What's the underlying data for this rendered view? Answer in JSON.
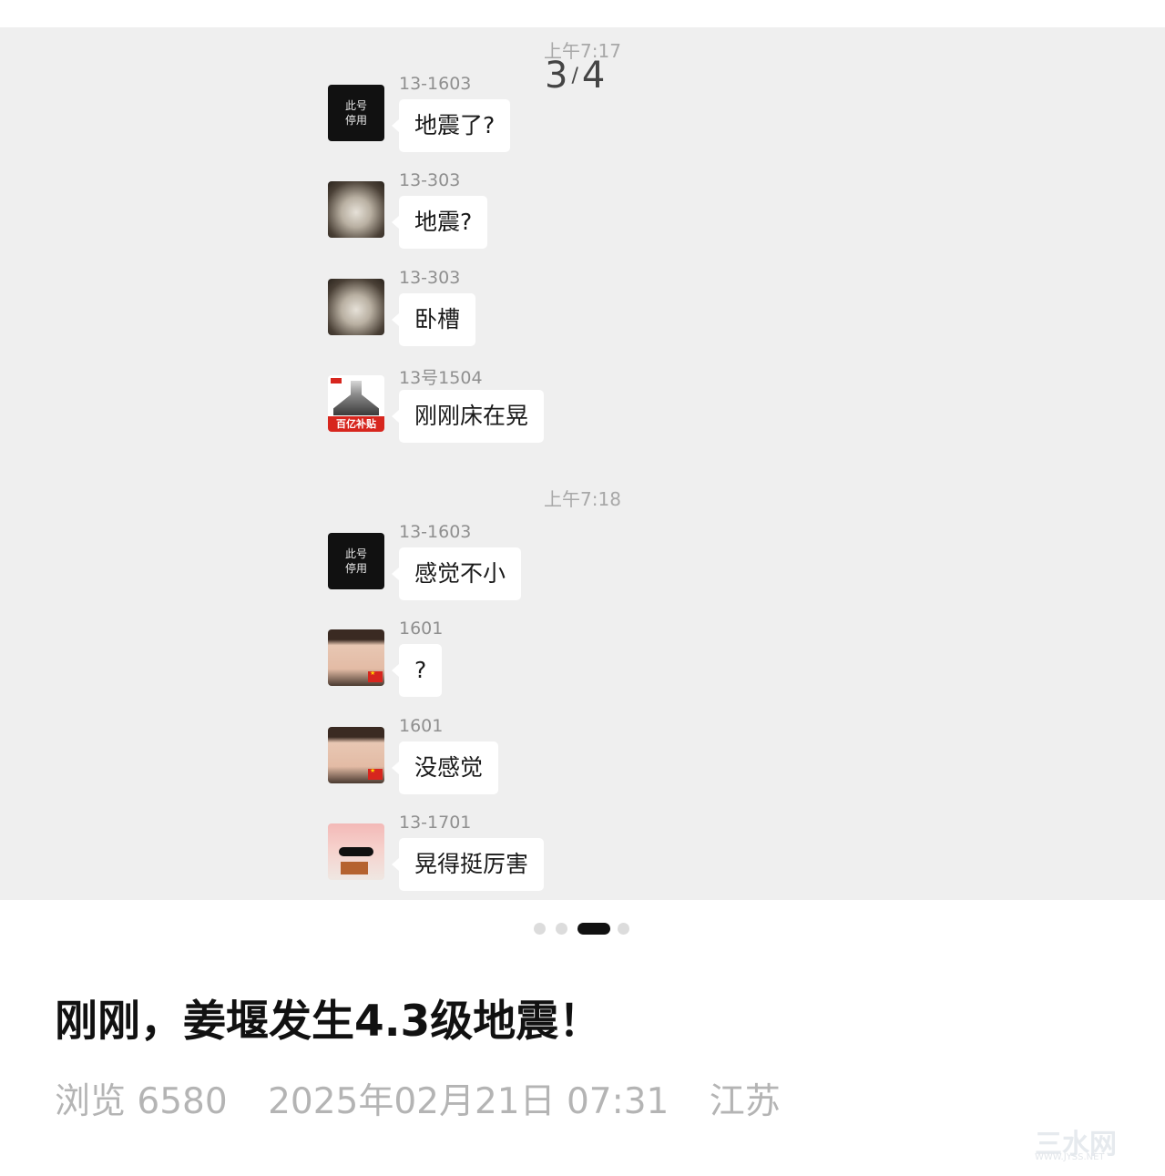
{
  "chat": {
    "page_counter": {
      "current": "3",
      "separator": "/",
      "total": "4"
    },
    "time_separators": [
      "上午7:17",
      "上午7:18"
    ],
    "messages": [
      {
        "sender": "13-1603",
        "text": "地震了?",
        "avatar": "black-tile-avatar",
        "avatar_text": [
          "此号",
          "停用"
        ]
      },
      {
        "sender": "13-303",
        "text": "地震?",
        "avatar": "cat-photo-avatar"
      },
      {
        "sender": "13-303",
        "text": "卧槽",
        "avatar": "cat-photo-avatar"
      },
      {
        "sender": "13号1504",
        "text": "刚刚床在晃",
        "avatar": "range-hood-avatar",
        "avatar_text": [
          "百亿补贴"
        ]
      },
      {
        "sender": "13-1603",
        "text": "感觉不小",
        "avatar": "black-tile-avatar",
        "avatar_text": [
          "此号",
          "停用"
        ]
      },
      {
        "sender": "1601",
        "text": "?",
        "avatar": "woman-photo-avatar"
      },
      {
        "sender": "1601",
        "text": "没感觉",
        "avatar": "woman-photo-avatar"
      },
      {
        "sender": "13-1701",
        "text": "晃得挺厉害",
        "avatar": "bear-photo-avatar"
      }
    ]
  },
  "carousel": {
    "total": 4,
    "active_index": 2
  },
  "article": {
    "title": "刚刚，姜堰发生4.3级地震！",
    "views_label": "浏览 6580",
    "date": "2025年02月21日 07:31",
    "location": "江苏"
  },
  "watermark": {
    "text": "三水网",
    "url": "WWW.JYSS.NET"
  },
  "colors": {
    "chat_bg": "#efefef",
    "bubble_bg": "#ffffff",
    "meta_text": "#b4b4b4",
    "active_dot": "#111111"
  }
}
